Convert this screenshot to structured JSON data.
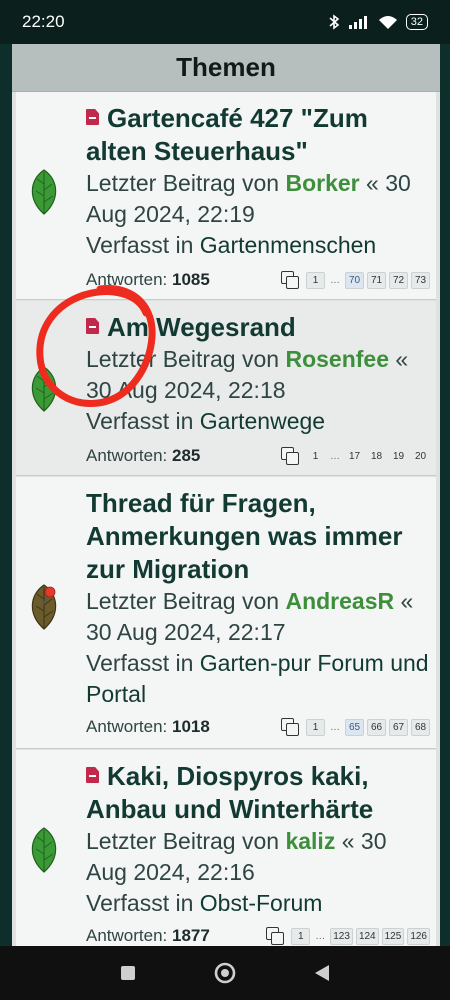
{
  "status_bar": {
    "time": "22:20",
    "battery": "32",
    "icons": [
      "bluetooth-icon",
      "signal-icon",
      "wifi-icon",
      "battery-icon"
    ]
  },
  "header": {
    "title": "Themen"
  },
  "labels": {
    "last_post_prefix": "Letzter Beitrag von",
    "posted_in": "Verfasst in",
    "replies": "Antworten:"
  },
  "topics": [
    {
      "title": "Gartencafé 427 \"Zum alten Steuerhaus\"",
      "user": "Borker",
      "date": "30 Aug 2024, 22:19",
      "forum": "Gartenmenschen",
      "replies": "1085",
      "pages": [
        "1",
        "…",
        "70",
        "71",
        "72",
        "73"
      ],
      "icon": "green-leaf-icon"
    },
    {
      "title": "Am Wegesrand",
      "user": "Rosenfee",
      "date": "30 Aug 2024, 22:18",
      "forum": "Gartenwege",
      "replies": "285",
      "pages": [
        "1",
        "…",
        "17",
        "18",
        "19",
        "20"
      ],
      "icon": "green-leaf-icon"
    },
    {
      "title": "Thread für Fragen, Anmerkungen was immer zur Migration",
      "user": "AndreasR",
      "date": "30 Aug 2024, 22:17",
      "forum": "Garten-pur Forum und Portal",
      "replies": "1018",
      "pages": [
        "1",
        "…",
        "65",
        "66",
        "67",
        "68"
      ],
      "icon": "pinned-leaf-icon"
    },
    {
      "title": "Kaki, Diospyros kaki, Anbau und Winterhärte",
      "user": "kaliz",
      "date": "30 Aug 2024, 22:16",
      "forum": "Obst-Forum",
      "replies": "1877",
      "pages": [
        "1",
        "…",
        "123",
        "124",
        "125",
        "126"
      ],
      "icon": "green-leaf-icon"
    }
  ],
  "nav": [
    "recent-apps-icon",
    "home-icon",
    "back-icon"
  ],
  "colors": {
    "background": "#0e2e2b",
    "user_green": "#3d8f3b",
    "title_dark": "#123a33",
    "doc_icon": "#c0294b",
    "annotation_red": "#ee2b1f"
  }
}
